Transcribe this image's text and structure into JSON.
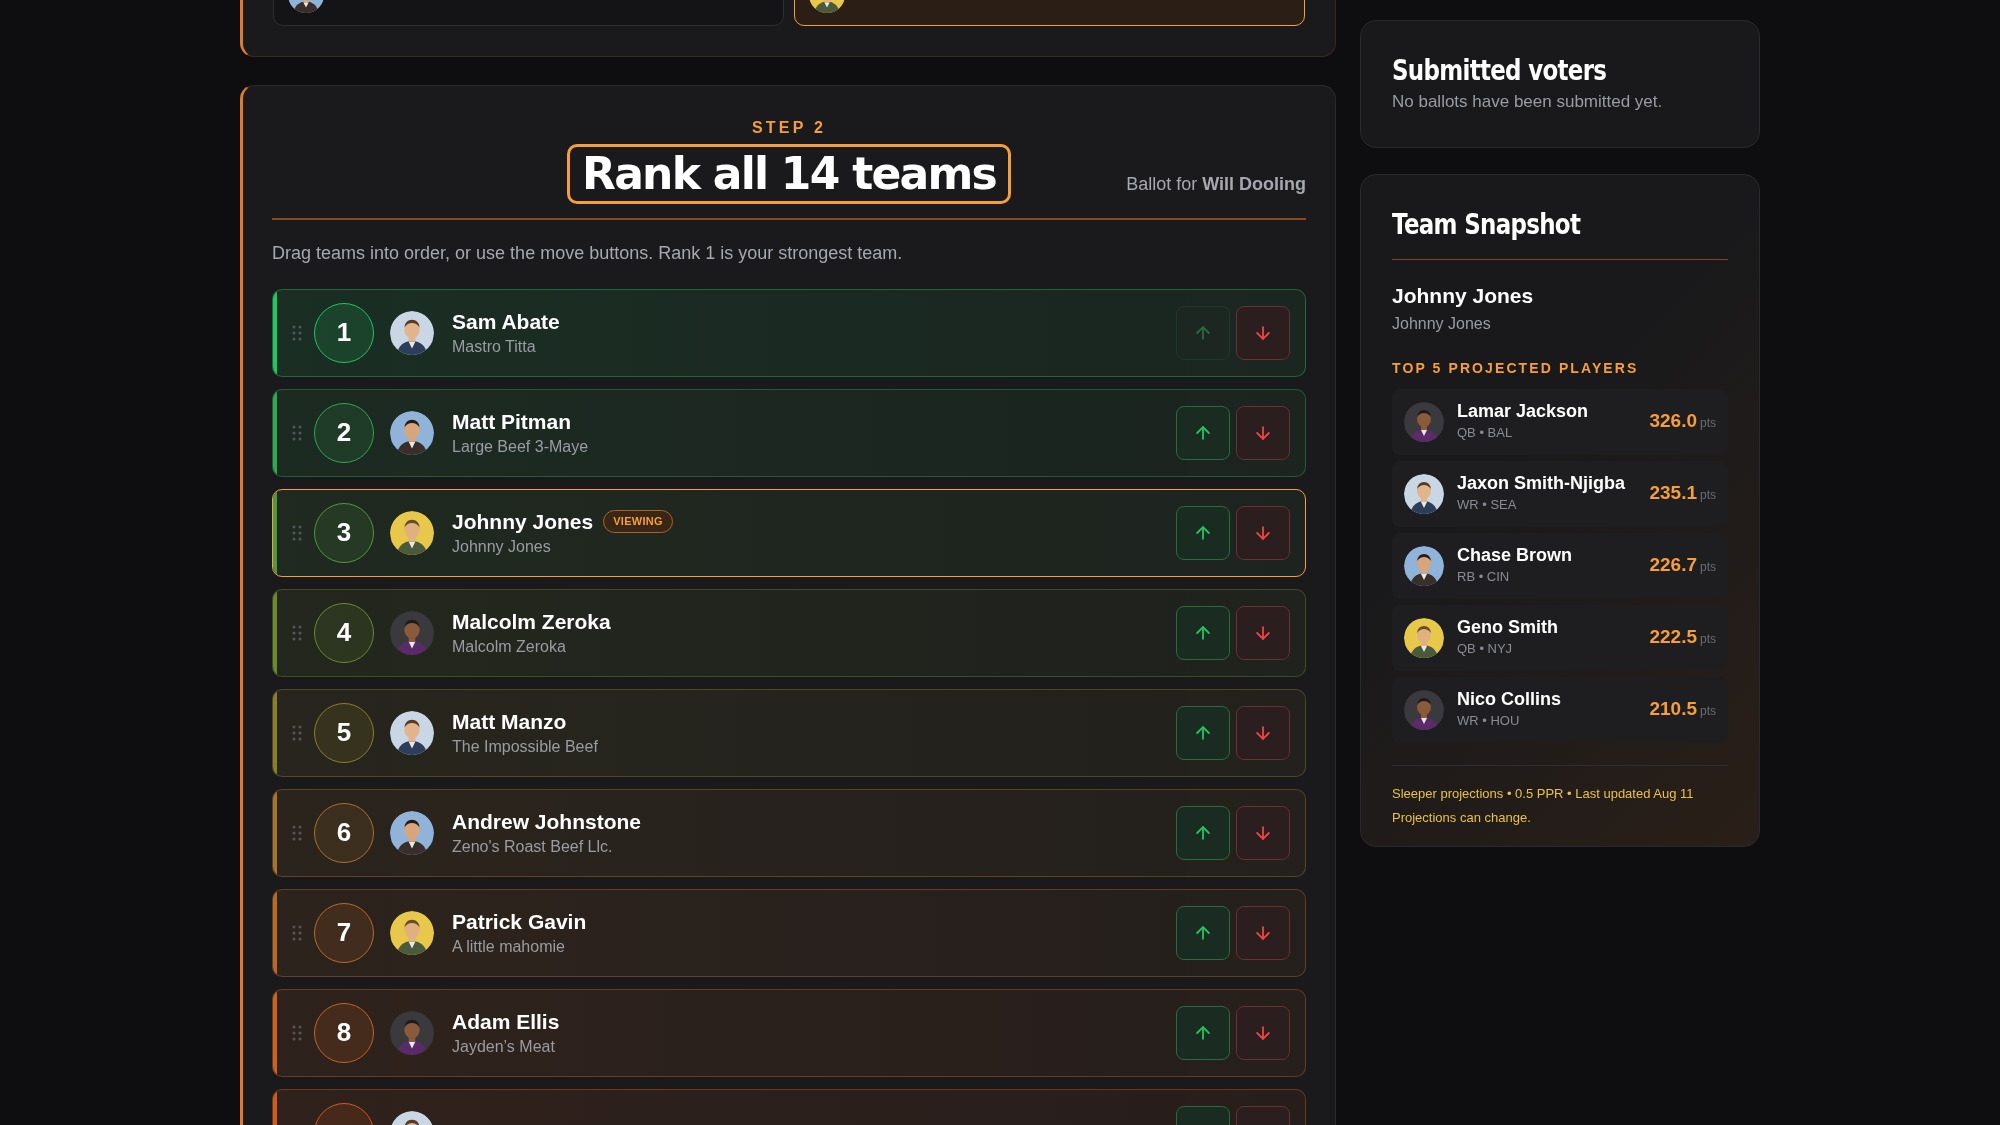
{
  "voter_picker": {
    "voters": [
      {
        "selected": false
      },
      {
        "selected": true
      }
    ]
  },
  "ranking": {
    "step": "STEP 2",
    "title": "Rank all 14 teams",
    "ballot": "Ballot for **Will Dooling**",
    "instructions": "Drag teams into order, or use the move buttons. Rank 1 is your strongest team.",
    "viewing_label": "VIEWING",
    "teams": [
      {
        "rank": "1",
        "name": "Sam Abate",
        "team": "Mastro Titta",
        "color": "#22c55e",
        "viewing": false,
        "up_disabled": true,
        "down_disabled": false
      },
      {
        "rank": "2",
        "name": "Matt Pitman",
        "team": "Large Beef 3-Maye",
        "color": "#2fa84f",
        "viewing": false,
        "up_disabled": false,
        "down_disabled": false
      },
      {
        "rank": "3",
        "name": "Johnny Jones",
        "team": "Johnny Jones",
        "color": "#4c9a3e",
        "viewing": true,
        "up_disabled": false,
        "down_disabled": false
      },
      {
        "rank": "4",
        "name": "Malcolm Zeroka",
        "team": "Malcolm Zeroka",
        "color": "#6b8a2e",
        "viewing": false,
        "up_disabled": false,
        "down_disabled": false
      },
      {
        "rank": "5",
        "name": "Matt Manzo",
        "team": "The Impossible Beef",
        "color": "#8c7f2a",
        "viewing": false,
        "up_disabled": false,
        "down_disabled": false
      },
      {
        "rank": "6",
        "name": "Andrew Johnstone",
        "team": "Zeno's Roast Beef Llc.",
        "color": "#a8732a",
        "viewing": false,
        "up_disabled": false,
        "down_disabled": false
      },
      {
        "rank": "7",
        "name": "Patrick Gavin",
        "team": "A little mahomie",
        "color": "#bb6a26",
        "viewing": false,
        "up_disabled": false,
        "down_disabled": false
      },
      {
        "rank": "8",
        "name": "Adam Ellis",
        "team": "Jayden’s Meat",
        "color": "#c9631f",
        "viewing": false,
        "up_disabled": false,
        "down_disabled": false
      },
      {
        "color": "#d15a1c",
        "viewing": false,
        "up_disabled": false,
        "down_disabled": false
      }
    ]
  },
  "submitted": {
    "title": "Submitted voters",
    "message": "No ballots have been submitted yet."
  },
  "snapshot": {
    "title": "Team Snapshot",
    "owner": "Johnny Jones",
    "team": "Johnny Jones",
    "players_heading": "TOP 5 PROJECTED PLAYERS",
    "players": [
      {
        "name": "Lamar Jackson",
        "meta": "QB • BAL",
        "points": "326.0",
        "unit": "pts"
      },
      {
        "name": "Jaxon Smith-Njigba",
        "meta": "WR • SEA",
        "points": "235.1",
        "unit": "pts"
      },
      {
        "name": "Chase Brown",
        "meta": "RB • CIN",
        "points": "226.7",
        "unit": "pts"
      },
      {
        "name": "Geno Smith",
        "meta": "QB • NYJ",
        "points": "222.5",
        "unit": "pts"
      },
      {
        "name": "Nico Collins",
        "meta": "WR • HOU",
        "points": "210.5",
        "unit": "pts"
      }
    ],
    "footnote": "Sleeper projections • 0.5 PPR • Last updated Aug 11",
    "disclaimer": "Projections can change."
  }
}
